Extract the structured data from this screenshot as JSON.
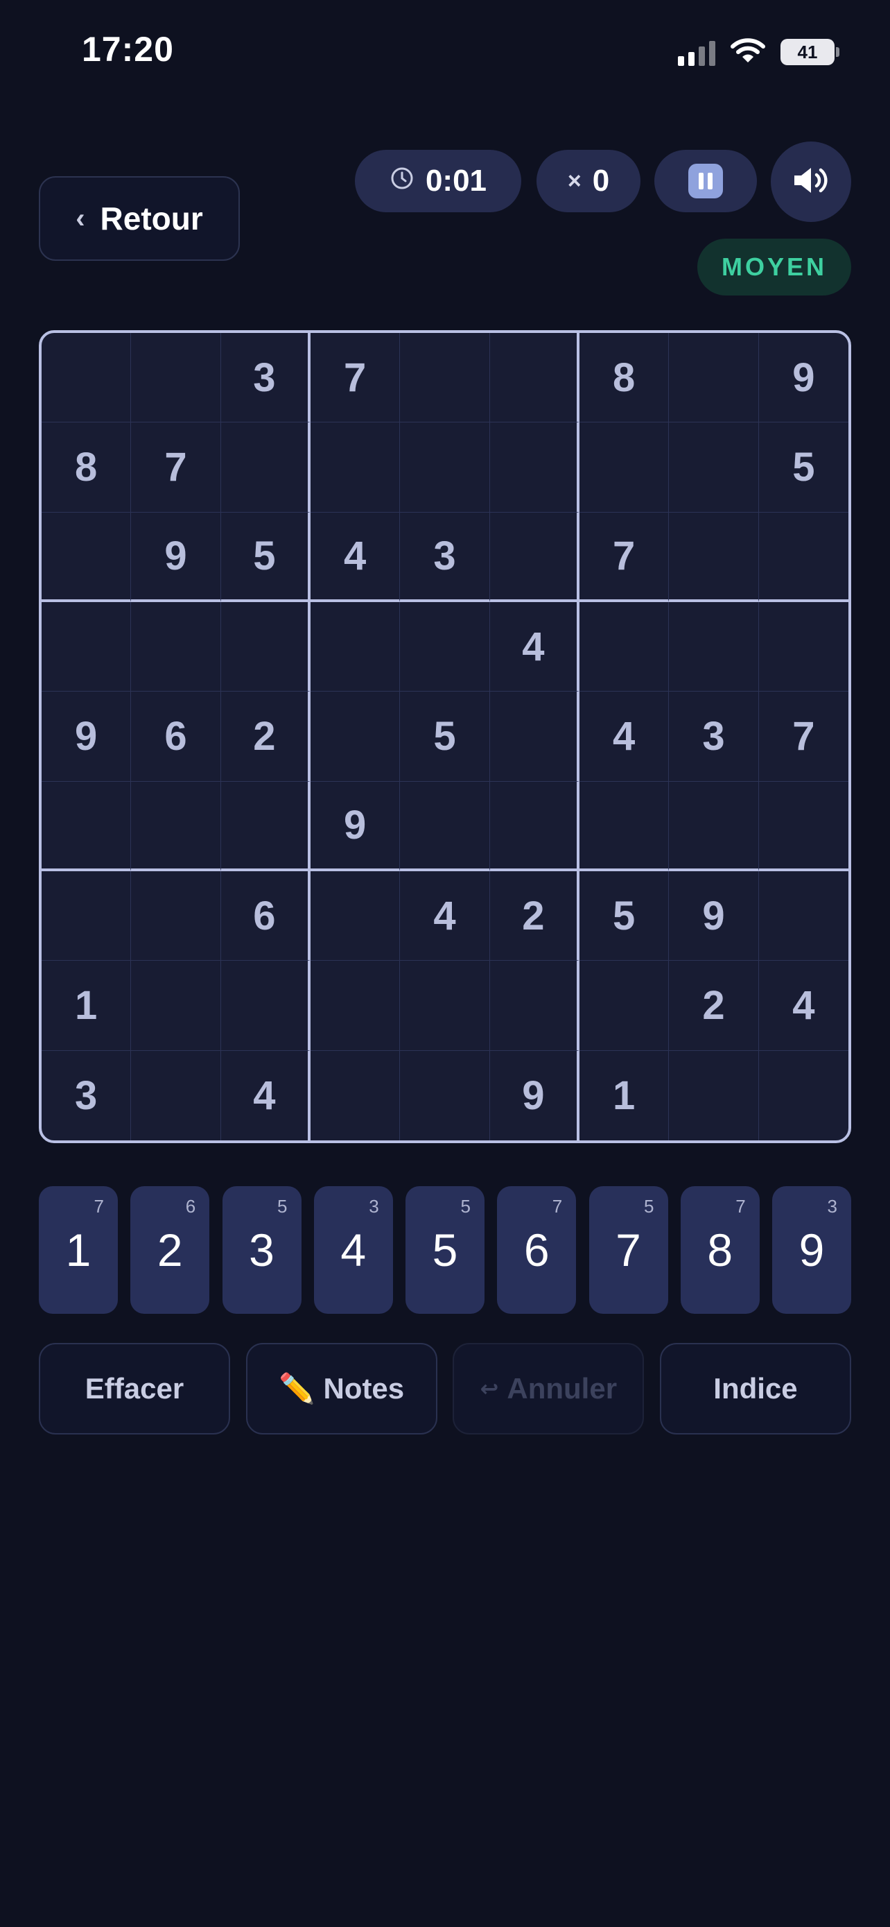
{
  "status_bar": {
    "time": "17:20",
    "battery": "41",
    "icons": [
      "cellular-signal-icon",
      "wifi-icon",
      "battery-icon"
    ]
  },
  "header": {
    "back_label": "Retour",
    "timer": "0:01",
    "errors_prefix": "×",
    "errors": "0",
    "difficulty": "MOYEN"
  },
  "colors": {
    "background": "#0e1120",
    "pill": "#262c4f",
    "difficulty_text": "#3ed0a0",
    "grid_border": "#b9c0e4",
    "number_key": "#28305a"
  },
  "board": {
    "rows": [
      [
        "",
        "",
        "3",
        "7",
        "",
        "",
        "8",
        "",
        "9"
      ],
      [
        "8",
        "7",
        "",
        "",
        "",
        "",
        "",
        "",
        "5"
      ],
      [
        "",
        "9",
        "5",
        "4",
        "3",
        "",
        "7",
        "",
        ""
      ],
      [
        "",
        "",
        "",
        "",
        "",
        "4",
        "",
        "",
        ""
      ],
      [
        "9",
        "6",
        "2",
        "",
        "5",
        "",
        "4",
        "3",
        "7"
      ],
      [
        "",
        "",
        "",
        "9",
        "",
        "",
        "",
        "",
        ""
      ],
      [
        "",
        "",
        "6",
        "",
        "4",
        "2",
        "5",
        "9",
        ""
      ],
      [
        "1",
        "",
        "",
        "",
        "",
        "",
        "",
        "2",
        "4"
      ],
      [
        "3",
        "",
        "4",
        "",
        "",
        "9",
        "1",
        "",
        ""
      ]
    ]
  },
  "number_pad": [
    {
      "digit": "1",
      "remaining": "7"
    },
    {
      "digit": "2",
      "remaining": "6"
    },
    {
      "digit": "3",
      "remaining": "5"
    },
    {
      "digit": "4",
      "remaining": "3"
    },
    {
      "digit": "5",
      "remaining": "5"
    },
    {
      "digit": "6",
      "remaining": "7"
    },
    {
      "digit": "7",
      "remaining": "5"
    },
    {
      "digit": "8",
      "remaining": "7"
    },
    {
      "digit": "9",
      "remaining": "3"
    }
  ],
  "actions": {
    "erase": "Effacer",
    "notes_icon": "✏️",
    "notes": "Notes",
    "undo_icon": "↩",
    "undo": "Annuler",
    "hint": "Indice"
  }
}
